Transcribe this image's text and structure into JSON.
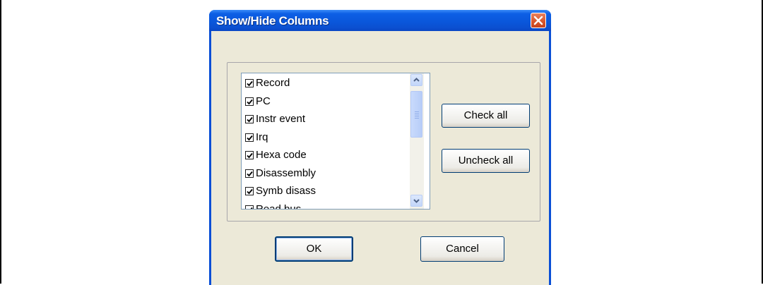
{
  "dialog": {
    "title": "Show/Hide Columns",
    "close_icon": "close-icon"
  },
  "columns_list": {
    "items": [
      {
        "label": "Record",
        "checked": true
      },
      {
        "label": "PC",
        "checked": true
      },
      {
        "label": "Instr event",
        "checked": true
      },
      {
        "label": "Irq",
        "checked": true
      },
      {
        "label": "Hexa code",
        "checked": true
      },
      {
        "label": "Disassembly",
        "checked": true
      },
      {
        "label": "Symb disass",
        "checked": true
      },
      {
        "label": "Read bus",
        "checked": true
      }
    ]
  },
  "buttons": {
    "check_all": "Check all",
    "uncheck_all": "Uncheck all",
    "ok": "OK",
    "cancel": "Cancel"
  },
  "colors": {
    "titlebar": "#0a56da",
    "dialog_bg": "#ece9d8",
    "close_button": "#d8542a"
  }
}
